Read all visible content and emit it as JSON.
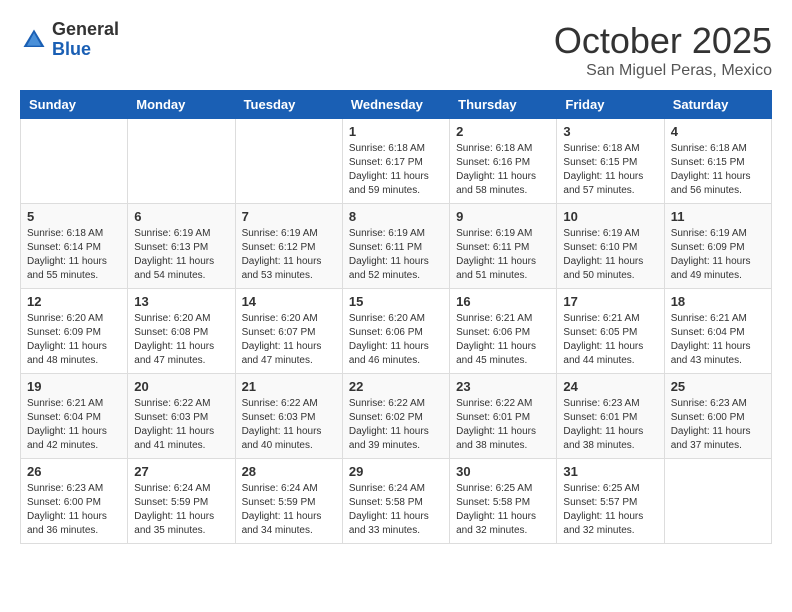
{
  "header": {
    "logo_general": "General",
    "logo_blue": "Blue",
    "month_title": "October 2025",
    "location": "San Miguel Peras, Mexico"
  },
  "weekdays": [
    "Sunday",
    "Monday",
    "Tuesday",
    "Wednesday",
    "Thursday",
    "Friday",
    "Saturday"
  ],
  "weeks": [
    [
      {
        "day": "",
        "sunrise": "",
        "sunset": "",
        "daylight": ""
      },
      {
        "day": "",
        "sunrise": "",
        "sunset": "",
        "daylight": ""
      },
      {
        "day": "",
        "sunrise": "",
        "sunset": "",
        "daylight": ""
      },
      {
        "day": "1",
        "sunrise": "6:18 AM",
        "sunset": "6:17 PM",
        "daylight": "11 hours and 59 minutes."
      },
      {
        "day": "2",
        "sunrise": "6:18 AM",
        "sunset": "6:16 PM",
        "daylight": "11 hours and 58 minutes."
      },
      {
        "day": "3",
        "sunrise": "6:18 AM",
        "sunset": "6:15 PM",
        "daylight": "11 hours and 57 minutes."
      },
      {
        "day": "4",
        "sunrise": "6:18 AM",
        "sunset": "6:15 PM",
        "daylight": "11 hours and 56 minutes."
      }
    ],
    [
      {
        "day": "5",
        "sunrise": "6:18 AM",
        "sunset": "6:14 PM",
        "daylight": "11 hours and 55 minutes."
      },
      {
        "day": "6",
        "sunrise": "6:19 AM",
        "sunset": "6:13 PM",
        "daylight": "11 hours and 54 minutes."
      },
      {
        "day": "7",
        "sunrise": "6:19 AM",
        "sunset": "6:12 PM",
        "daylight": "11 hours and 53 minutes."
      },
      {
        "day": "8",
        "sunrise": "6:19 AM",
        "sunset": "6:11 PM",
        "daylight": "11 hours and 52 minutes."
      },
      {
        "day": "9",
        "sunrise": "6:19 AM",
        "sunset": "6:11 PM",
        "daylight": "11 hours and 51 minutes."
      },
      {
        "day": "10",
        "sunrise": "6:19 AM",
        "sunset": "6:10 PM",
        "daylight": "11 hours and 50 minutes."
      },
      {
        "day": "11",
        "sunrise": "6:19 AM",
        "sunset": "6:09 PM",
        "daylight": "11 hours and 49 minutes."
      }
    ],
    [
      {
        "day": "12",
        "sunrise": "6:20 AM",
        "sunset": "6:09 PM",
        "daylight": "11 hours and 48 minutes."
      },
      {
        "day": "13",
        "sunrise": "6:20 AM",
        "sunset": "6:08 PM",
        "daylight": "11 hours and 47 minutes."
      },
      {
        "day": "14",
        "sunrise": "6:20 AM",
        "sunset": "6:07 PM",
        "daylight": "11 hours and 47 minutes."
      },
      {
        "day": "15",
        "sunrise": "6:20 AM",
        "sunset": "6:06 PM",
        "daylight": "11 hours and 46 minutes."
      },
      {
        "day": "16",
        "sunrise": "6:21 AM",
        "sunset": "6:06 PM",
        "daylight": "11 hours and 45 minutes."
      },
      {
        "day": "17",
        "sunrise": "6:21 AM",
        "sunset": "6:05 PM",
        "daylight": "11 hours and 44 minutes."
      },
      {
        "day": "18",
        "sunrise": "6:21 AM",
        "sunset": "6:04 PM",
        "daylight": "11 hours and 43 minutes."
      }
    ],
    [
      {
        "day": "19",
        "sunrise": "6:21 AM",
        "sunset": "6:04 PM",
        "daylight": "11 hours and 42 minutes."
      },
      {
        "day": "20",
        "sunrise": "6:22 AM",
        "sunset": "6:03 PM",
        "daylight": "11 hours and 41 minutes."
      },
      {
        "day": "21",
        "sunrise": "6:22 AM",
        "sunset": "6:03 PM",
        "daylight": "11 hours and 40 minutes."
      },
      {
        "day": "22",
        "sunrise": "6:22 AM",
        "sunset": "6:02 PM",
        "daylight": "11 hours and 39 minutes."
      },
      {
        "day": "23",
        "sunrise": "6:22 AM",
        "sunset": "6:01 PM",
        "daylight": "11 hours and 38 minutes."
      },
      {
        "day": "24",
        "sunrise": "6:23 AM",
        "sunset": "6:01 PM",
        "daylight": "11 hours and 38 minutes."
      },
      {
        "day": "25",
        "sunrise": "6:23 AM",
        "sunset": "6:00 PM",
        "daylight": "11 hours and 37 minutes."
      }
    ],
    [
      {
        "day": "26",
        "sunrise": "6:23 AM",
        "sunset": "6:00 PM",
        "daylight": "11 hours and 36 minutes."
      },
      {
        "day": "27",
        "sunrise": "6:24 AM",
        "sunset": "5:59 PM",
        "daylight": "11 hours and 35 minutes."
      },
      {
        "day": "28",
        "sunrise": "6:24 AM",
        "sunset": "5:59 PM",
        "daylight": "11 hours and 34 minutes."
      },
      {
        "day": "29",
        "sunrise": "6:24 AM",
        "sunset": "5:58 PM",
        "daylight": "11 hours and 33 minutes."
      },
      {
        "day": "30",
        "sunrise": "6:25 AM",
        "sunset": "5:58 PM",
        "daylight": "11 hours and 32 minutes."
      },
      {
        "day": "31",
        "sunrise": "6:25 AM",
        "sunset": "5:57 PM",
        "daylight": "11 hours and 32 minutes."
      },
      {
        "day": "",
        "sunrise": "",
        "sunset": "",
        "daylight": ""
      }
    ]
  ]
}
